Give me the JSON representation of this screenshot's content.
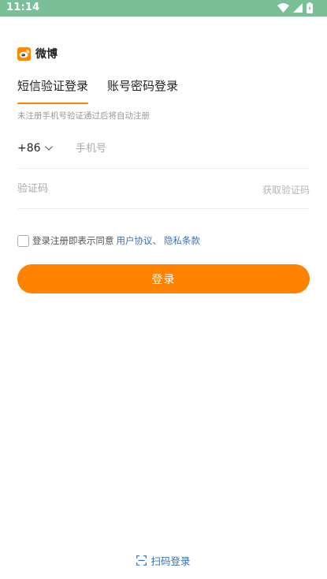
{
  "status_bar": {
    "time": "11:14"
  },
  "app": {
    "name": "微博"
  },
  "tabs": [
    {
      "label": "短信验证登录",
      "active": true
    },
    {
      "label": "账号密码登录",
      "active": false
    }
  ],
  "hint": "未注册手机号验证通过后将自动注册",
  "phone": {
    "country_code": "+86",
    "value": "",
    "placeholder": "手机号"
  },
  "code": {
    "value": "",
    "placeholder": "验证码",
    "get_code_label": "获取验证码"
  },
  "agreement": {
    "text": "登录注册即表示同意",
    "user_agreement": "用户协议",
    "separator": "、",
    "privacy_policy": "隐私条款",
    "checked": false
  },
  "login_button": {
    "label": "登录"
  },
  "scan_login": {
    "label": "扫码登录"
  },
  "colors": {
    "accent": "#ff8200",
    "link": "#3a70b5",
    "status_bar": "#7abf98"
  }
}
